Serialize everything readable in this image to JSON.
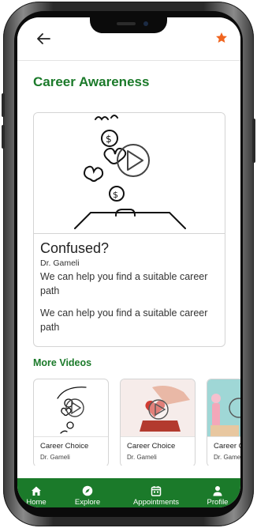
{
  "header": {
    "back_icon": "arrow-left-icon",
    "favorite_icon": "star-icon",
    "accent": "#f0641e"
  },
  "page": {
    "title": "Career Awareness",
    "title_color": "#1b7a2a"
  },
  "featured_video": {
    "title": "Confused?",
    "author": "Dr. Gameli",
    "description": "We can help you find a suitable career path",
    "description_repeat": "We can help you find a suitable career path",
    "play_icon": "play-icon"
  },
  "more_videos": {
    "title": "More Videos",
    "items": [
      {
        "title": "Career Choice",
        "author": "Dr. Gameli"
      },
      {
        "title": "Career Choice",
        "author": "Dr. Gameli"
      },
      {
        "title": "Career Choice",
        "author": "Dr. Gameli"
      }
    ]
  },
  "bottom_nav": {
    "background": "#1b7a2a",
    "items": [
      {
        "label": "Home",
        "icon": "home-icon"
      },
      {
        "label": "Explore",
        "icon": "compass-icon"
      },
      {
        "label": "Appointments",
        "icon": "calendar-icon"
      },
      {
        "label": "Profile",
        "icon": "person-icon"
      }
    ]
  }
}
